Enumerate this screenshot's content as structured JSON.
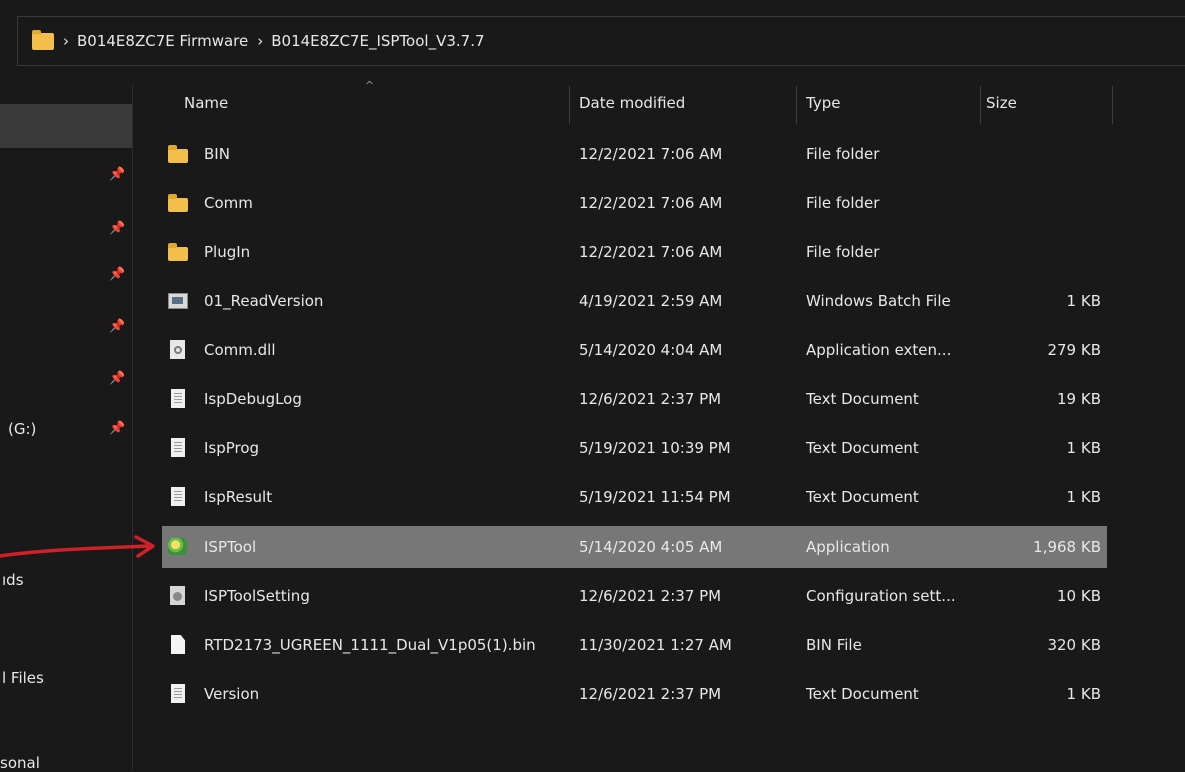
{
  "window": {
    "breadcrumb": {
      "separator": "›",
      "items": [
        "B014E8ZC7E Firmware",
        "B014E8ZC7E_ISPTool_V3.7.7"
      ]
    }
  },
  "nav": {
    "items": [
      {
        "label": ""
      },
      {
        "label": ""
      },
      {
        "label": ""
      },
      {
        "label": ""
      },
      {
        "label": ""
      },
      {
        "label": "(G:)"
      },
      {
        "label": "ıds"
      },
      {
        "label": "l Files"
      },
      {
        "label": "sonal"
      }
    ],
    "pin_glyph": "📌"
  },
  "columns": {
    "name": "Name",
    "date": "Date modified",
    "type": "Type",
    "size": "Size",
    "sort_glyph": "^"
  },
  "files": [
    {
      "name": "BIN",
      "date": "12/2/2021 7:06 AM",
      "type": "File folder",
      "size": "",
      "icon": "folder-icon"
    },
    {
      "name": "Comm",
      "date": "12/2/2021 7:06 AM",
      "type": "File folder",
      "size": "",
      "icon": "folder-icon"
    },
    {
      "name": "PlugIn",
      "date": "12/2/2021 7:06 AM",
      "type": "File folder",
      "size": "",
      "icon": "folder-icon"
    },
    {
      "name": "01_ReadVersion",
      "date": "4/19/2021 2:59 AM",
      "type": "Windows Batch File",
      "size": "1 KB",
      "icon": "batch-file-icon"
    },
    {
      "name": "Comm.dll",
      "date": "5/14/2020 4:04 AM",
      "type": "Application exten...",
      "size": "279 KB",
      "icon": "dll-file-icon"
    },
    {
      "name": "IspDebugLog",
      "date": "12/6/2021 2:37 PM",
      "type": "Text Document",
      "size": "19 KB",
      "icon": "text-document-icon"
    },
    {
      "name": "IspProg",
      "date": "5/19/2021 10:39 PM",
      "type": "Text Document",
      "size": "1 KB",
      "icon": "text-document-icon"
    },
    {
      "name": "IspResult",
      "date": "5/19/2021 11:54 PM",
      "type": "Text Document",
      "size": "1 KB",
      "icon": "text-document-icon"
    },
    {
      "name": "ISPTool",
      "date": "5/14/2020 4:05 AM",
      "type": "Application",
      "size": "1,968 KB",
      "icon": "application-icon",
      "selected": true
    },
    {
      "name": "ISPToolSetting",
      "date": "12/6/2021 2:37 PM",
      "type": "Configuration sett...",
      "size": "10 KB",
      "icon": "config-file-icon"
    },
    {
      "name": "RTD2173_UGREEN_1111_Dual_V1p05(1).bin",
      "date": "11/30/2021 1:27 AM",
      "type": "BIN File",
      "size": "320 KB",
      "icon": "bin-file-icon"
    },
    {
      "name": "Version",
      "date": "12/6/2021 2:37 PM",
      "type": "Text Document",
      "size": "1 KB",
      "icon": "text-document-icon"
    }
  ],
  "annotation": {
    "color": "#d0202a"
  },
  "colors": {
    "background": "#191919",
    "selected_row": "#777777",
    "text": "#e8e8e8"
  }
}
